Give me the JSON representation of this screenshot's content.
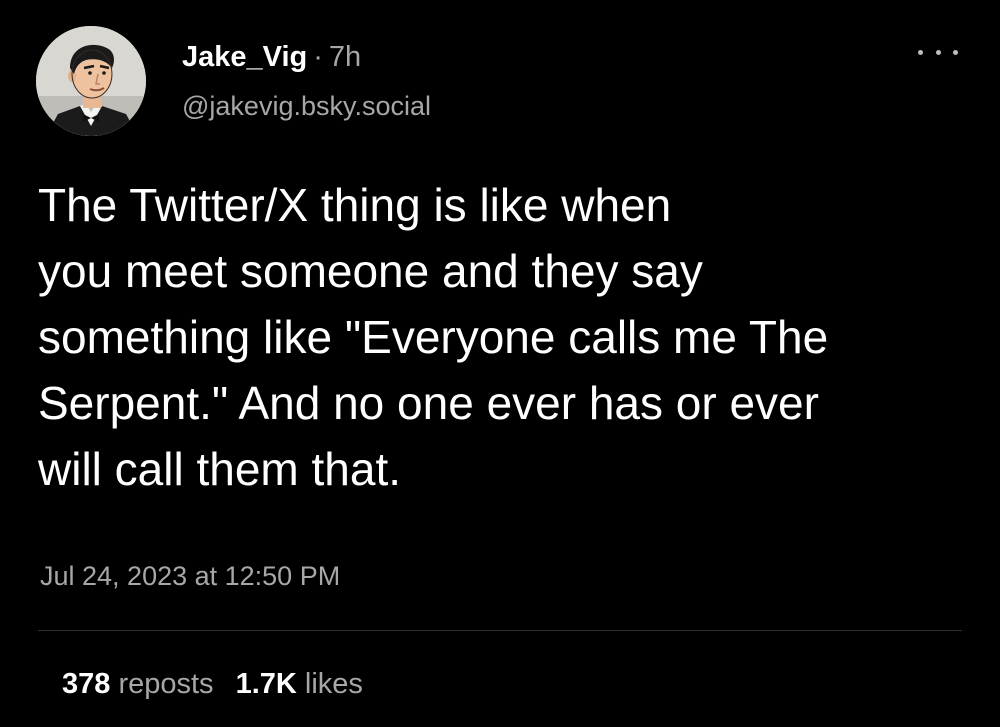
{
  "post": {
    "author": {
      "display_name": "Jake_Vig",
      "separator": "·",
      "relative_time": "7h",
      "handle": "@jakevig.bsky.social",
      "avatar_icon": "cartoon-man-tuxedo-avatar"
    },
    "menu_icon": "more-horizontal-icon",
    "text_lines": [
      "The Twitter/X thing is like when",
      "you meet someone and they say",
      "something like \"Everyone calls me The",
      "Serpent.\" And no one ever has or ever",
      "will call them that."
    ],
    "timestamp": "Jul 24, 2023 at 12:50 PM",
    "stats": {
      "reposts_count": "378",
      "reposts_label": "reposts",
      "likes_count": "1.7K",
      "likes_label": "likes"
    }
  },
  "colors": {
    "background": "#000000",
    "primary_text": "#ffffff",
    "secondary_text": "#a7a7a7",
    "divider": "#2f2f2f"
  }
}
